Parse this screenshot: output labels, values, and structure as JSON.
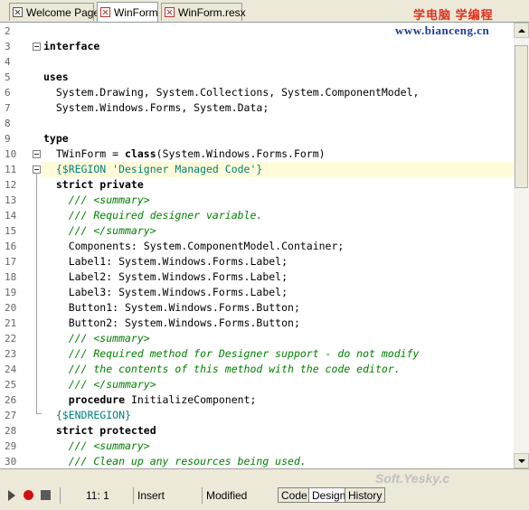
{
  "tabs": [
    {
      "label": "Welcome Page",
      "active": false
    },
    {
      "label": "WinForm",
      "active": true
    },
    {
      "label": "WinForm.resx",
      "active": false
    }
  ],
  "watermark": {
    "cn": "学电脑 学编程",
    "url": "www.bianceng.cn",
    "soft": "Soft.Yesky.c"
  },
  "editor": {
    "lines": [
      {
        "n": "2",
        "segs": [
          {
            "t": "",
            "s": ""
          }
        ]
      },
      {
        "n": "3",
        "segs": [
          {
            "t": "interface",
            "s": "kw"
          }
        ]
      },
      {
        "n": "4",
        "segs": [
          {
            "t": "",
            "s": ""
          }
        ]
      },
      {
        "n": "5",
        "segs": [
          {
            "t": "uses",
            "s": "kw"
          }
        ]
      },
      {
        "n": "6",
        "segs": [
          {
            "t": "  System.Drawing, System.Collections, System.ComponentModel,",
            "s": ""
          }
        ]
      },
      {
        "n": "7",
        "segs": [
          {
            "t": "  System.Windows.Forms, System.Data;",
            "s": ""
          }
        ]
      },
      {
        "n": "8",
        "segs": [
          {
            "t": "",
            "s": ""
          }
        ]
      },
      {
        "n": "9",
        "segs": [
          {
            "t": "type",
            "s": "kw"
          }
        ]
      },
      {
        "n": "10",
        "segs": [
          {
            "t": "  TWinForm = ",
            "s": ""
          },
          {
            "t": "class",
            "s": "kw"
          },
          {
            "t": "(System.Windows.Forms.Form)",
            "s": ""
          }
        ]
      },
      {
        "n": "11",
        "segs": [
          {
            "t": "  {$REGION 'Designer Managed Code'}",
            "s": "dr"
          }
        ],
        "current": true
      },
      {
        "n": "12",
        "segs": [
          {
            "t": "  strict private",
            "s": "kw"
          }
        ]
      },
      {
        "n": "13",
        "segs": [
          {
            "t": "    /// <summary>",
            "s": "cm"
          }
        ]
      },
      {
        "n": "14",
        "segs": [
          {
            "t": "    /// Required designer variable.",
            "s": "cm"
          }
        ]
      },
      {
        "n": "15",
        "segs": [
          {
            "t": "    /// </summary>",
            "s": "cm"
          }
        ]
      },
      {
        "n": "16",
        "segs": [
          {
            "t": "    Components: System.ComponentModel.Container;",
            "s": ""
          }
        ]
      },
      {
        "n": "17",
        "segs": [
          {
            "t": "    Label1: System.Windows.Forms.Label;",
            "s": ""
          }
        ]
      },
      {
        "n": "18",
        "segs": [
          {
            "t": "    Label2: System.Windows.Forms.Label;",
            "s": ""
          }
        ]
      },
      {
        "n": "19",
        "segs": [
          {
            "t": "    Label3: System.Windows.Forms.Label;",
            "s": ""
          }
        ]
      },
      {
        "n": "20",
        "segs": [
          {
            "t": "    Button1: System.Windows.Forms.Button;",
            "s": ""
          }
        ]
      },
      {
        "n": "21",
        "segs": [
          {
            "t": "    Button2: System.Windows.Forms.Button;",
            "s": ""
          }
        ]
      },
      {
        "n": "22",
        "segs": [
          {
            "t": "    /// <summary>",
            "s": "cm"
          }
        ]
      },
      {
        "n": "23",
        "segs": [
          {
            "t": "    /// Required method for Designer support - do not modify",
            "s": "cm"
          }
        ]
      },
      {
        "n": "24",
        "segs": [
          {
            "t": "    /// the contents of this method with the code editor.",
            "s": "cm"
          }
        ]
      },
      {
        "n": "25",
        "segs": [
          {
            "t": "    /// </summary>",
            "s": "cm"
          }
        ]
      },
      {
        "n": "26",
        "segs": [
          {
            "t": "    ",
            "s": ""
          },
          {
            "t": "procedure",
            "s": "kw"
          },
          {
            "t": " InitializeComponent;",
            "s": ""
          }
        ]
      },
      {
        "n": "27",
        "segs": [
          {
            "t": "  {$ENDREGION}",
            "s": "dr"
          }
        ]
      },
      {
        "n": "28",
        "segs": [
          {
            "t": "  strict protected",
            "s": "kw"
          }
        ]
      },
      {
        "n": "29",
        "segs": [
          {
            "t": "    /// <summary>",
            "s": "cm"
          }
        ]
      },
      {
        "n": "30",
        "segs": [
          {
            "t": "    /// Clean up any resources being used.",
            "s": "cm"
          }
        ]
      }
    ]
  },
  "status": {
    "position": "11:  1",
    "mode": "Insert",
    "modified": "Modified",
    "view_tabs": [
      {
        "label": "Code",
        "active": false
      },
      {
        "label": "Design",
        "active": true
      },
      {
        "label": "History",
        "active": false
      }
    ]
  }
}
